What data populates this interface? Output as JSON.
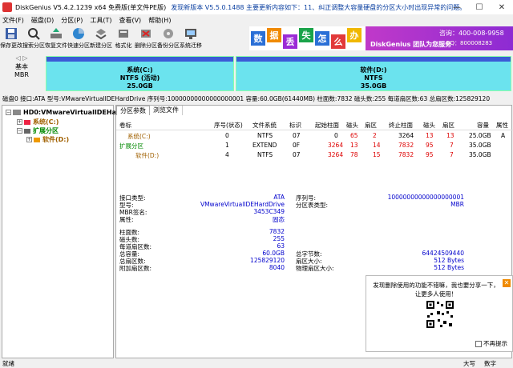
{
  "titlebar": {
    "title": "DiskGenius V5.4.2.1239 x64 免费版(单文件PE版)",
    "update_notice": "发现新版本 V5.5.0.1488   主要更新内容如下：11、纠正调整大容量硬盘的分区大小时出现异常的问题。"
  },
  "menu": [
    "文件(F)",
    "磁盘(D)",
    "分区(P)",
    "工具(T)",
    "查看(V)",
    "帮助(H)"
  ],
  "toolbar": [
    {
      "label": "保存更改",
      "icon": "save-icon"
    },
    {
      "label": "搜索分区",
      "icon": "search-icon"
    },
    {
      "label": "恢复文件",
      "icon": "recover-icon"
    },
    {
      "label": "快速分区",
      "icon": "quick-partition-icon"
    },
    {
      "label": "新建分区",
      "icon": "new-partition-icon"
    },
    {
      "label": "格式化",
      "icon": "format-icon"
    },
    {
      "label": "删除分区",
      "icon": "delete-icon"
    },
    {
      "label": "备份分区",
      "icon": "backup-icon"
    },
    {
      "label": "系统迁移",
      "icon": "migrate-icon"
    }
  ],
  "banner": {
    "tiles": [
      "数",
      "据",
      "丢",
      "失",
      "怎",
      "么",
      "办"
    ],
    "brand": "DiskGenius 团队为您服务",
    "phone": "咨询：400-008-9958",
    "qq": "QQ：800008283"
  },
  "disk_strip": {
    "label_line1": "基本",
    "label_line2": "MBR",
    "partitions": [
      {
        "name": "系统(C:)",
        "fs": "NTFS (活动)",
        "size": "25.0GB"
      },
      {
        "name": "软件(D:)",
        "fs": "NTFS",
        "size": "35.0GB"
      }
    ]
  },
  "infoline": "磁盘0 接口:ATA  型号:VMwareVirtualIDEHardDrive  序列号:10000000000000000001  容量:60.0GB(61440MB)  柱面数:7832  磁头数:255  每道扇区数:63  总扇区数:125829120",
  "tree": {
    "disk": "HD0:VMwareVirtualIDEHardDrive",
    "items": [
      "系统(C:)",
      "扩展分区",
      "软件(D:)"
    ]
  },
  "tabs": [
    "分区参数",
    "浏览文件"
  ],
  "partition_table": {
    "headers": [
      "卷标",
      "序号(状态)",
      "文件系统",
      "标识",
      "起始柱面",
      "磁头",
      "扇区",
      "终止柱面",
      "磁头",
      "扇区",
      "容量",
      "属性"
    ],
    "rows": [
      [
        "系统(C:)",
        "0",
        "NTFS",
        "07",
        "0",
        "65",
        "2",
        "3264",
        "13",
        "13",
        "25.0GB",
        "A"
      ],
      [
        "扩展分区",
        "1",
        "EXTEND",
        "0F",
        "3264",
        "13",
        "14",
        "7832",
        "95",
        "7",
        "35.0GB",
        ""
      ],
      [
        "软件(D:)",
        "4",
        "NTFS",
        "07",
        "3264",
        "78",
        "15",
        "7832",
        "95",
        "7",
        "35.0GB",
        ""
      ]
    ]
  },
  "details": {
    "iface_k": "接口类型:",
    "iface_v": "ATA",
    "model_k": "型号:",
    "model_v": "VMwareVirtualIDEHardDrive",
    "mbrsig_k": "MBR签名:",
    "mbrsig_v": "3453C349",
    "attr_k": "属性:",
    "attr_v": "固态",
    "serial_k": "序列号:",
    "serial_v": "10000000000000000001",
    "ptype_k": "分区表类型:",
    "ptype_v": "MBR",
    "cyl_k": "柱面数:",
    "cyl_v": "7832",
    "heads_k": "磁头数:",
    "heads_v": "255",
    "spt_k": "每道扇区数:",
    "spt_v": "63",
    "cap_k": "总容量:",
    "cap_v": "60.0GB",
    "totsec_k": "总扇区数:",
    "totsec_v": "125829120",
    "extra_k": "附加扇区数:",
    "extra_v": "8040",
    "bytes_k": "总字节数:",
    "bytes_v": "64424509440",
    "secsize_k": "扇区大小:",
    "secsize_v": "512 Bytes",
    "physsec_k": "物理扇区大小:",
    "physsec_v": "512 Bytes"
  },
  "popup": {
    "message": "发现删除使用的功能不错嘛，我也要分享一下，让更多人使用！",
    "checkbox": "不再提示"
  },
  "statusbar": {
    "left": "就绪",
    "caps": "大写",
    "num": "数字"
  },
  "colors": {
    "partition_fill": "#6be3ee",
    "partition_stripe": "#3b5bd6",
    "brand_purple": "#b537cc"
  }
}
